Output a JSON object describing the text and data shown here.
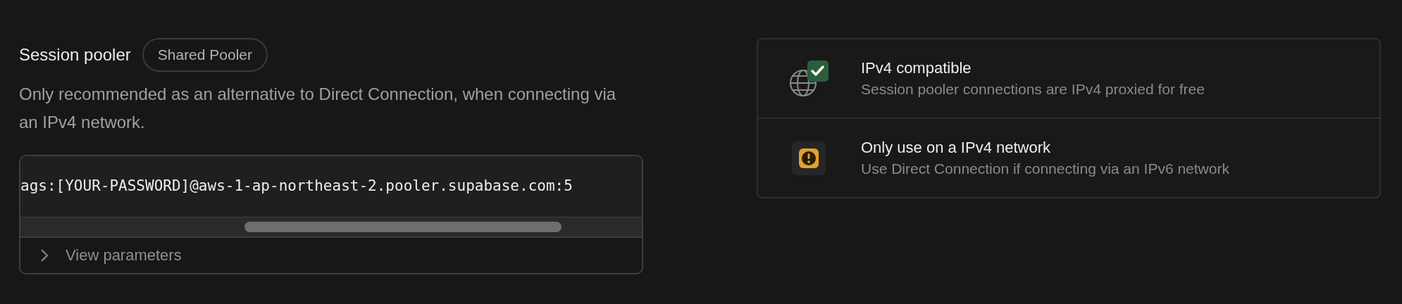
{
  "section": {
    "title": "Session pooler",
    "badge": "Shared Pooler",
    "description": "Only recommended as an alternative to Direct Connection, when connecting via an IPv4 network.",
    "connection_string": "ags:[YOUR-PASSWORD]@aws-1-ap-northeast-2.pooler.supabase.com:5",
    "parameters_toggle": {
      "label": "View parameters",
      "expanded": false
    }
  },
  "notices": [
    {
      "kind": "compatible",
      "title": "IPv4 compatible",
      "description": "Session pooler connections are IPv4 proxied for free"
    },
    {
      "kind": "warning",
      "title": "Only use on a IPv4 network",
      "description": "Use Direct Connection if connecting via an IPv6 network"
    }
  ]
}
